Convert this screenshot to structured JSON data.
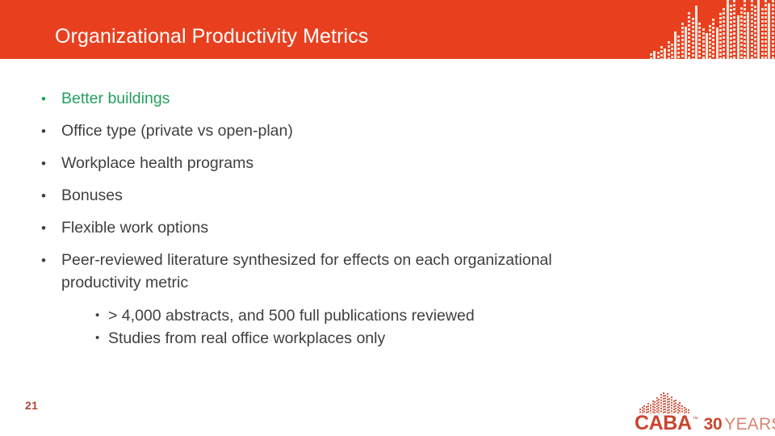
{
  "header": {
    "title": "Organizational Productivity Metrics",
    "background_color": "#e8401f",
    "title_color": "#ffffff",
    "decoration": "skyline-bars-pattern"
  },
  "content": {
    "bullets": [
      {
        "text": "Better buildings",
        "marker": "•",
        "accent": true
      },
      {
        "text": "Office type (private vs open-plan)",
        "marker": "•",
        "accent": false
      },
      {
        "text": "Workplace health programs",
        "marker": "•",
        "accent": false
      },
      {
        "text": "Bonuses",
        "marker": "•",
        "accent": false
      },
      {
        "text": "Flexible work options",
        "marker": "•",
        "accent": false
      },
      {
        "text": "Peer-reviewed literature synthesized for effects on each organizational productivity metric",
        "marker": "•",
        "accent": false
      }
    ],
    "sub_bullets": [
      {
        "text": "> 4,000 abstracts, and 500 full publications reviewed",
        "marker": "•"
      },
      {
        "text": "Studies from real office workplaces only",
        "marker": "•"
      }
    ],
    "accent_color": "#22a05a",
    "body_text_color": "#3f3f3f"
  },
  "footer": {
    "page_number": "21",
    "page_number_color": "#a8493a",
    "logo": {
      "mark": "caba-skyline-icon",
      "name": "CABA",
      "trademark": "™",
      "anniversary_number": "30",
      "anniversary_word": "YEARS",
      "brand_color": "#c8452e",
      "years_color": "#d98675"
    }
  }
}
